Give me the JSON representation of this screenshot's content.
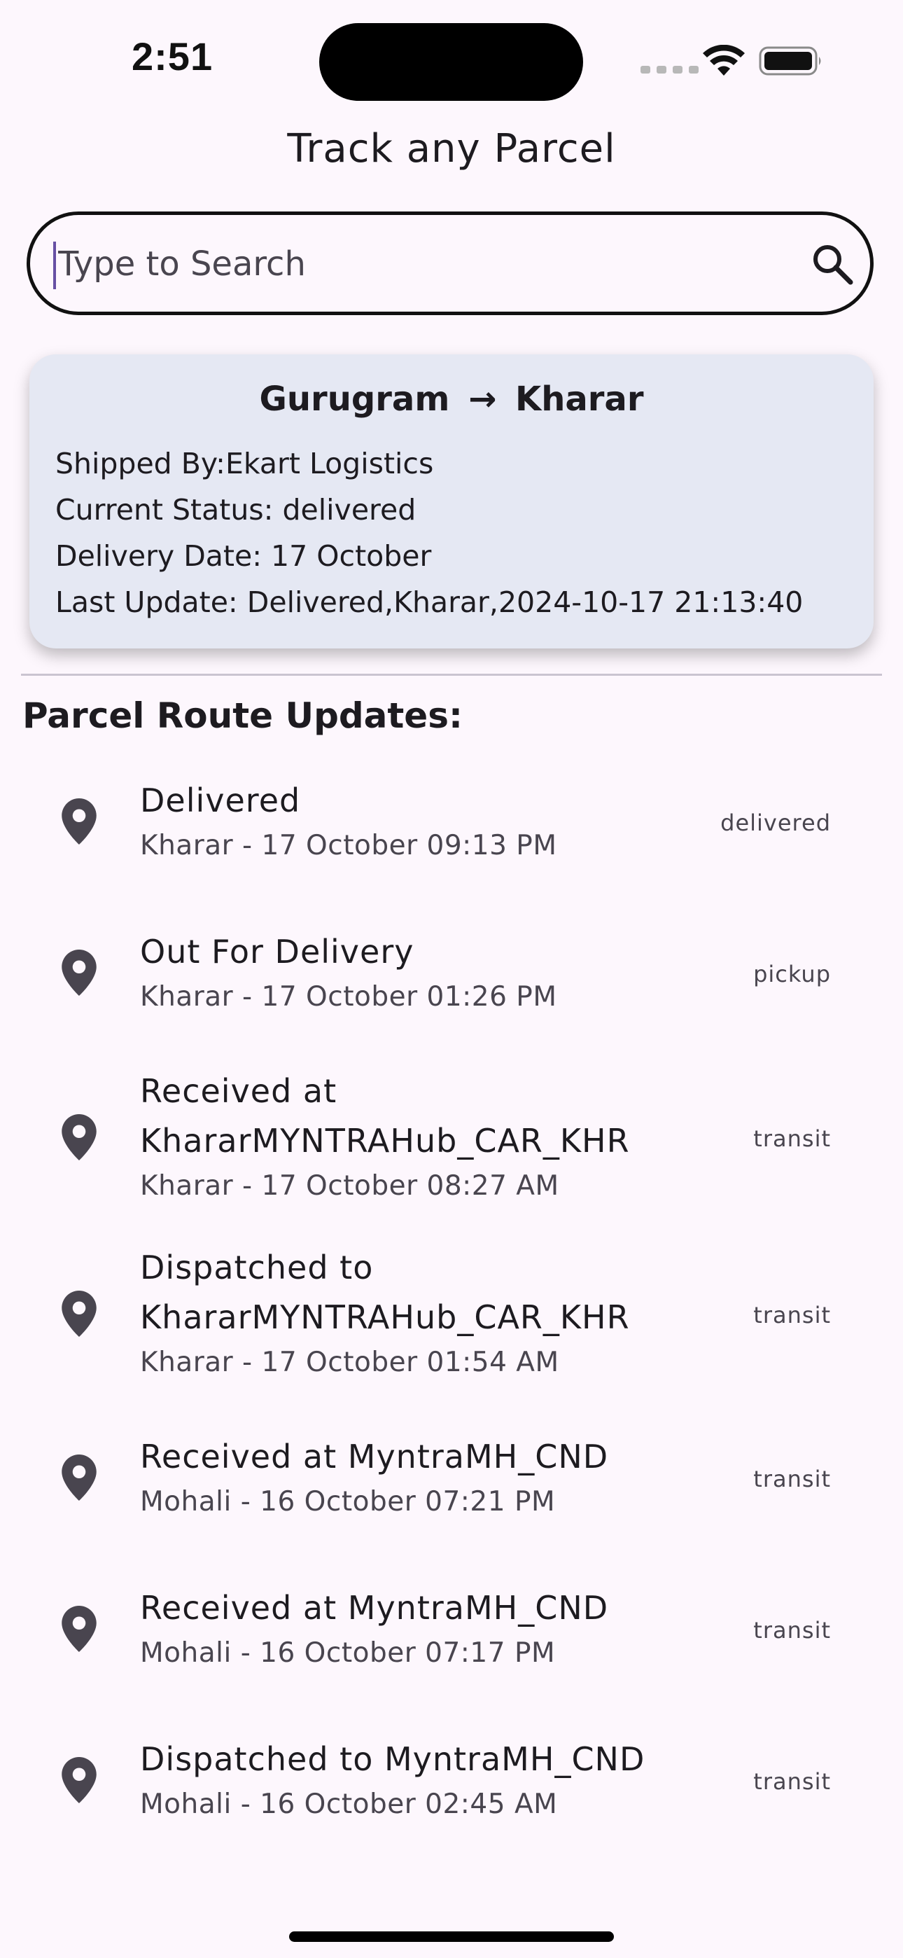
{
  "status_bar": {
    "time": "2:51"
  },
  "header": {
    "title": "Track any Parcel"
  },
  "search": {
    "placeholder": "Type to Search",
    "value": ""
  },
  "summary": {
    "origin": "Gurugram",
    "arrow": "→",
    "destination": "Kharar",
    "shipped_by": "Shipped By:Ekart Logistics",
    "current_status": "Current Status: delivered",
    "delivery_date": "Delivery Date: 17 October",
    "last_update": "Last Update: Delivered,Kharar,2024-10-17 21:13:40"
  },
  "updates_section": {
    "title": "Parcel Route Updates:"
  },
  "updates": [
    {
      "title": "Delivered",
      "subtitle": "Kharar - 17 October 09:13 PM",
      "status": "delivered",
      "icon": "location-pin-icon"
    },
    {
      "title": "Out For Delivery",
      "subtitle": "Kharar - 17 October 01:26 PM",
      "status": "pickup",
      "icon": "location-pin-icon"
    },
    {
      "title": "Received at KhararMYNTRAHub_CAR_KHR",
      "subtitle": "Kharar - 17 October 08:27 AM",
      "status": "transit",
      "icon": "location-pin-icon"
    },
    {
      "title": "Dispatched to KhararMYNTRAHub_CAR_KHR",
      "subtitle": "Kharar - 17 October 01:54 AM",
      "status": "transit",
      "icon": "location-pin-icon"
    },
    {
      "title": "Received at MyntraMH_CND",
      "subtitle": "Mohali - 16 October 07:21 PM",
      "status": "transit",
      "icon": "location-pin-icon"
    },
    {
      "title": "Received at MyntraMH_CND",
      "subtitle": "Mohali - 16 October 07:17 PM",
      "status": "transit",
      "icon": "location-pin-icon"
    },
    {
      "title": "Dispatched to MyntraMH_CND",
      "subtitle": "Mohali - 16 October 02:45 AM",
      "status": "transit",
      "icon": "location-pin-icon"
    }
  ],
  "colors": {
    "background": "#fdf7fd",
    "card": "#e5e8f3",
    "text": "#1d1b20",
    "muted": "#49454f",
    "accent": "#6750a4"
  }
}
